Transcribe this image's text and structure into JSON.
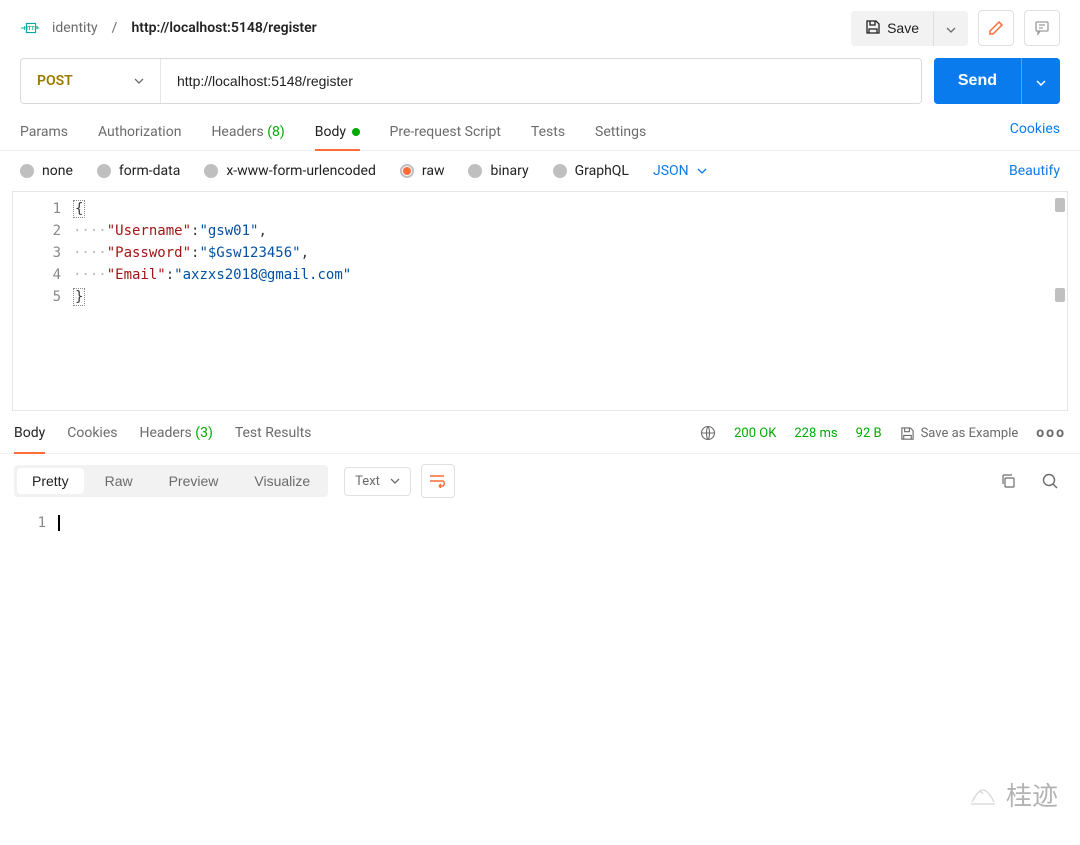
{
  "breadcrumb": {
    "parent": "identity",
    "sep": "/",
    "current": "http://localhost:5148/register"
  },
  "top": {
    "save_label": "Save"
  },
  "request": {
    "method": "POST",
    "url": "http://localhost:5148/register",
    "send_label": "Send"
  },
  "request_tabs": {
    "params": "Params",
    "authorization": "Authorization",
    "headers": "Headers",
    "headers_count": "(8)",
    "body": "Body",
    "prerequest": "Pre-request Script",
    "tests": "Tests",
    "settings": "Settings",
    "cookies": "Cookies"
  },
  "body_types": {
    "none": "none",
    "form_data": "form-data",
    "xwww": "x-www-form-urlencoded",
    "raw": "raw",
    "binary": "binary",
    "graphql": "GraphQL",
    "json_label": "JSON",
    "beautify": "Beautify"
  },
  "editor": {
    "line1_open": "{",
    "dots": "····",
    "l2_key": "\"Username\"",
    "l2_val": "\"gsw01\"",
    "l3_key": "\"Password\"",
    "l3_val": "\"$Gsw123456\"",
    "l4_key": "\"Email\"",
    "l4_val": "\"axzxs2018@gmail.com\"",
    "line5_close": "}",
    "line_numbers": [
      "1",
      "2",
      "3",
      "4",
      "5"
    ]
  },
  "response_tabs": {
    "body": "Body",
    "cookies": "Cookies",
    "headers": "Headers",
    "headers_count": "(3)",
    "test_results": "Test Results"
  },
  "response_status": {
    "code": "200 OK",
    "time": "228 ms",
    "size": "92 B",
    "save_example": "Save as Example"
  },
  "response_views": {
    "pretty": "Pretty",
    "raw": "Raw",
    "preview": "Preview",
    "visualize": "Visualize",
    "format": "Text"
  },
  "response_editor": {
    "line_numbers": [
      "1"
    ]
  },
  "watermark": "桂迹"
}
